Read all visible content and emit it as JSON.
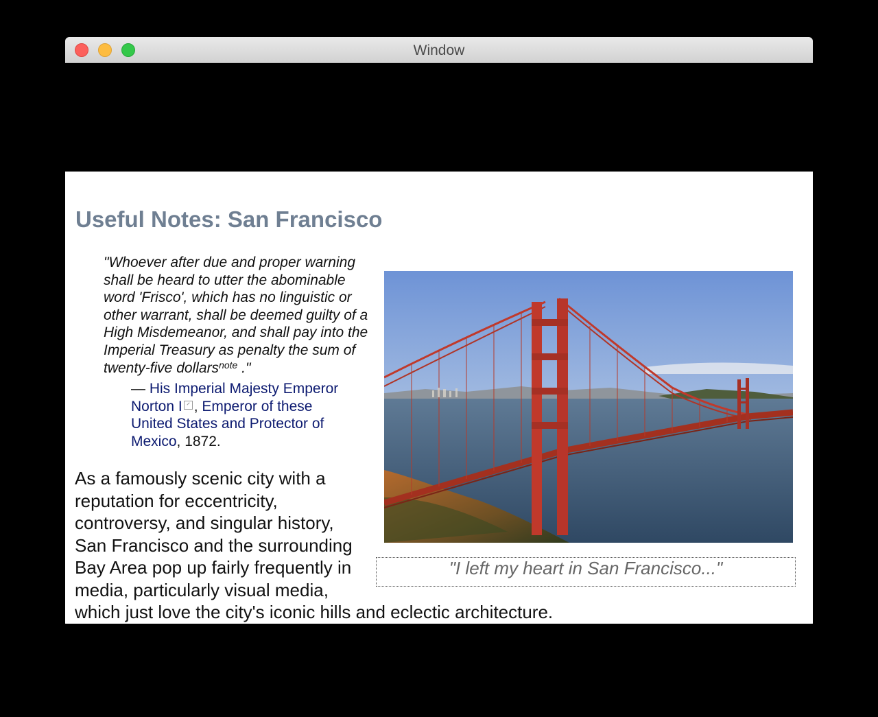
{
  "window": {
    "title": "Window"
  },
  "page": {
    "heading": "Useful Notes: San Francisco",
    "quote": {
      "text": "\"Whoever after due and proper warning shall be heard to utter the abominable word 'Frisco', which has no linguistic or other warrant, shall be deemed guilty of a High Misdemeanor, and shall pay into the Imperial Treasury as penalty the sum of twenty-five dollars",
      "note_label": "note",
      "closing": " .\""
    },
    "attribution": {
      "dash": "— ",
      "link1": "His Imperial Majesty Emperor Norton I",
      "link2": "Emperor of these United States and Protector of Mexico",
      "separator": ", ",
      "suffix": ", 1872."
    },
    "paragraph": "As a famously scenic city with a reputation for eccentricity, controversy, and singular history, San Francisco and the surrounding Bay Area pop up fairly frequently in media, particularly visual media, which just love the city's iconic hills and eclectic architecture.",
    "image_caption": "\"I left my heart in San Francisco...\""
  },
  "colors": {
    "heading": "#6f7f92",
    "link": "#0c1a70",
    "caption_text": "#666666"
  }
}
